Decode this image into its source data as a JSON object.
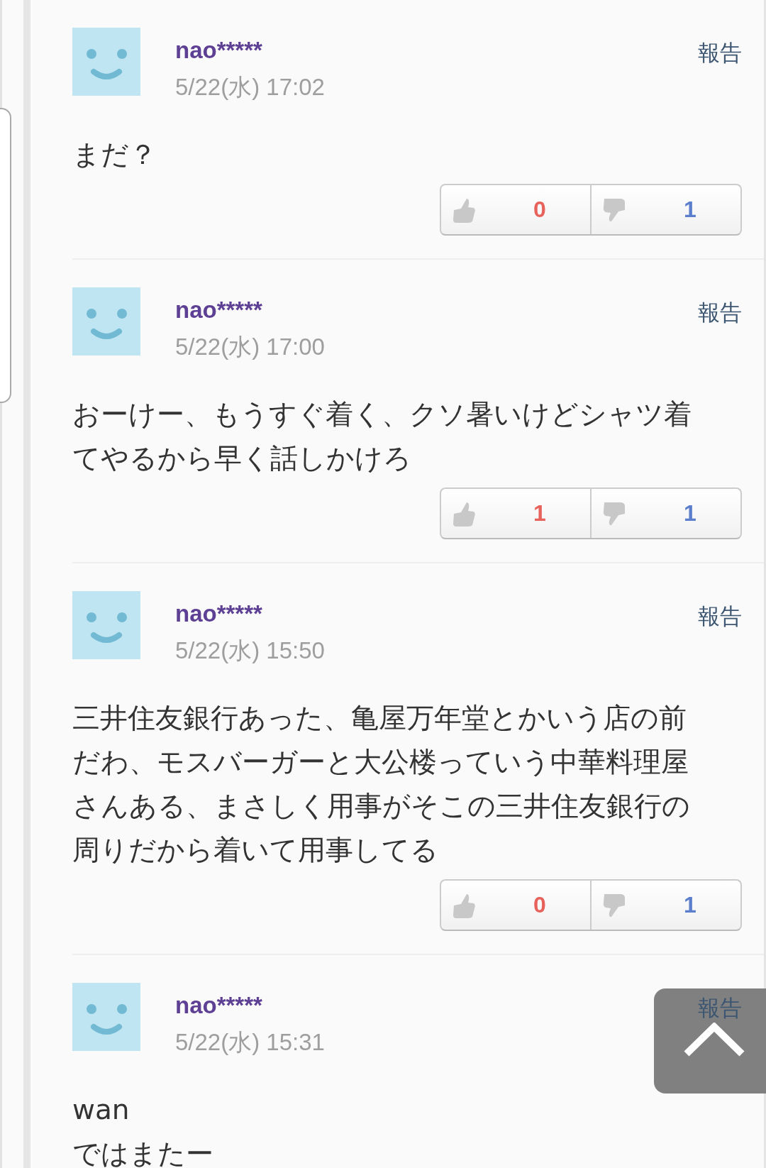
{
  "comments": [
    {
      "user": "nao*****",
      "date": "5/22(水) 17:02",
      "report": "報告",
      "body": [
        "まだ？"
      ],
      "votes": {
        "up": "0",
        "down": "1"
      }
    },
    {
      "user": "nao*****",
      "date": "5/22(水) 17:00",
      "report": "報告",
      "body": [
        "おーけー、もうすぐ着く、クソ暑いけどシャツ着てやるから早く話しかけろ"
      ],
      "votes": {
        "up": "1",
        "down": "1"
      }
    },
    {
      "user": "nao*****",
      "date": "5/22(水) 15:50",
      "report": "報告",
      "body": [
        "三井住友銀行あった、亀屋万年堂とかいう店の前だわ、モスバーガーと大公楼っていう中華料理屋さんある、まさしく用事がそこの三井住友銀行の周りだから着いて用事してる"
      ],
      "votes": {
        "up": "0",
        "down": "1"
      }
    },
    {
      "user": "nao*****",
      "date": "5/22(水) 15:31",
      "report": "報告",
      "body": [
        "wan",
        "ではまたー"
      ]
    }
  ]
}
